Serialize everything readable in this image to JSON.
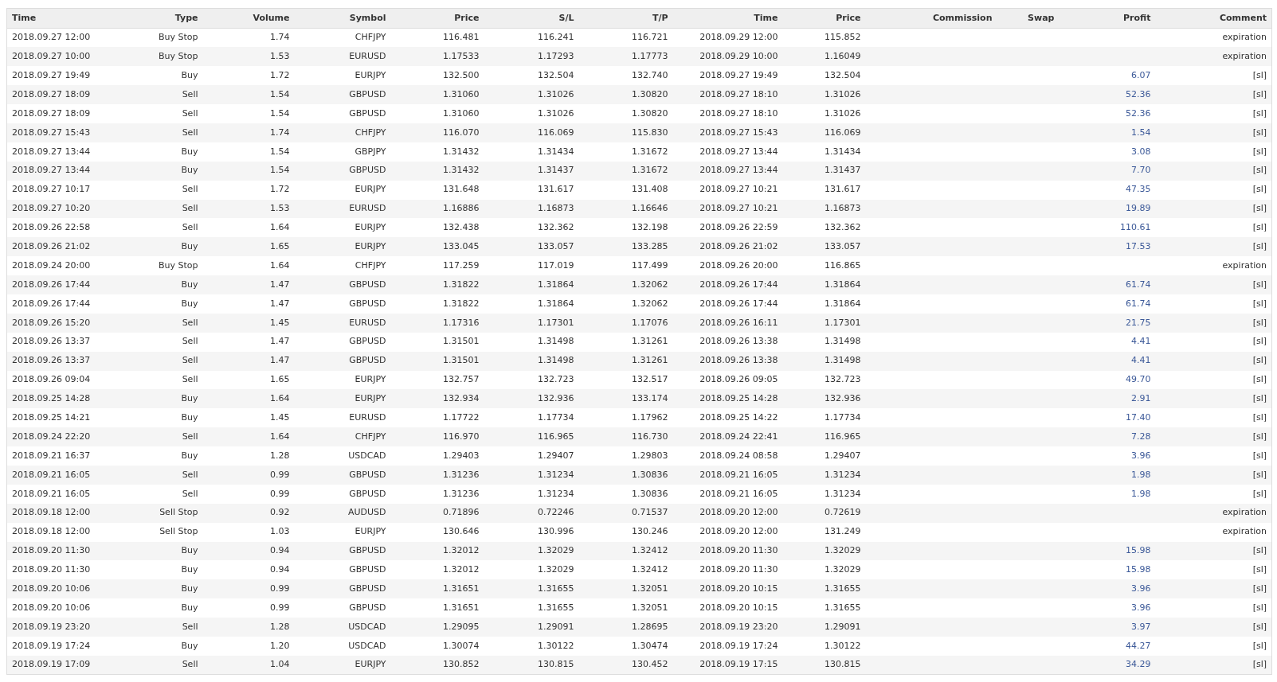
{
  "table": {
    "columns": [
      "Time",
      "Type",
      "Volume",
      "Symbol",
      "Price",
      "S/L",
      "T/P",
      "Time",
      "Price",
      "Commission",
      "Swap",
      "Profit",
      "Comment"
    ],
    "rows": [
      {
        "open_time": "2018.09.27 12:00",
        "type": "Buy Stop",
        "volume": "1.74",
        "symbol": "CHFJPY",
        "price": "116.481",
        "sl": "116.241",
        "tp": "116.721",
        "close_time": "2018.09.29 12:00",
        "close_price": "115.852",
        "comment": "expiration"
      },
      {
        "open_time": "2018.09.27 10:00",
        "type": "Buy Stop",
        "volume": "1.53",
        "symbol": "EURUSD",
        "price": "1.17533",
        "sl": "1.17293",
        "tp": "1.17773",
        "close_time": "2018.09.29 10:00",
        "close_price": "1.16049",
        "comment": "expiration"
      },
      {
        "open_time": "2018.09.27 19:49",
        "type": "Buy",
        "volume": "1.72",
        "symbol": "EURJPY",
        "price": "132.500",
        "sl": "132.504",
        "tp": "132.740",
        "close_time": "2018.09.27 19:49",
        "close_price": "132.504",
        "profit": "6.07",
        "comment": "[sl]"
      },
      {
        "open_time": "2018.09.27 18:09",
        "type": "Sell",
        "volume": "1.54",
        "symbol": "GBPUSD",
        "price": "1.31060",
        "sl": "1.31026",
        "tp": "1.30820",
        "close_time": "2018.09.27 18:10",
        "close_price": "1.31026",
        "profit": "52.36",
        "comment": "[sl]"
      },
      {
        "open_time": "2018.09.27 18:09",
        "type": "Sell",
        "volume": "1.54",
        "symbol": "GBPUSD",
        "price": "1.31060",
        "sl": "1.31026",
        "tp": "1.30820",
        "close_time": "2018.09.27 18:10",
        "close_price": "1.31026",
        "profit": "52.36",
        "comment": "[sl]"
      },
      {
        "open_time": "2018.09.27 15:43",
        "type": "Sell",
        "volume": "1.74",
        "symbol": "CHFJPY",
        "price": "116.070",
        "sl": "116.069",
        "tp": "115.830",
        "close_time": "2018.09.27 15:43",
        "close_price": "116.069",
        "profit": "1.54",
        "comment": "[sl]"
      },
      {
        "open_time": "2018.09.27 13:44",
        "type": "Buy",
        "volume": "1.54",
        "symbol": "GBPJPY",
        "price": "1.31432",
        "sl": "1.31434",
        "tp": "1.31672",
        "close_time": "2018.09.27 13:44",
        "close_price": "1.31434",
        "profit": "3.08",
        "comment": "[sl]"
      },
      {
        "open_time": "2018.09.27 13:44",
        "type": "Buy",
        "volume": "1.54",
        "symbol": "GBPUSD",
        "price": "1.31432",
        "sl": "1.31437",
        "tp": "1.31672",
        "close_time": "2018.09.27 13:44",
        "close_price": "1.31437",
        "profit": "7.70",
        "comment": "[sl]"
      },
      {
        "open_time": "2018.09.27 10:17",
        "type": "Sell",
        "volume": "1.72",
        "symbol": "EURJPY",
        "price": "131.648",
        "sl": "131.617",
        "tp": "131.408",
        "close_time": "2018.09.27 10:21",
        "close_price": "131.617",
        "profit": "47.35",
        "comment": "[sl]"
      },
      {
        "open_time": "2018.09.27 10:20",
        "type": "Sell",
        "volume": "1.53",
        "symbol": "EURUSD",
        "price": "1.16886",
        "sl": "1.16873",
        "tp": "1.16646",
        "close_time": "2018.09.27 10:21",
        "close_price": "1.16873",
        "profit": "19.89",
        "comment": "[sl]"
      },
      {
        "open_time": "2018.09.26 22:58",
        "type": "Sell",
        "volume": "1.64",
        "symbol": "EURJPY",
        "price": "132.438",
        "sl": "132.362",
        "tp": "132.198",
        "close_time": "2018.09.26 22:59",
        "close_price": "132.362",
        "profit": "110.61",
        "comment": "[sl]"
      },
      {
        "open_time": "2018.09.26 21:02",
        "type": "Buy",
        "volume": "1.65",
        "symbol": "EURJPY",
        "price": "133.045",
        "sl": "133.057",
        "tp": "133.285",
        "close_time": "2018.09.26 21:02",
        "close_price": "133.057",
        "profit": "17.53",
        "comment": "[sl]"
      },
      {
        "open_time": "2018.09.24 20:00",
        "type": "Buy Stop",
        "volume": "1.64",
        "symbol": "CHFJPY",
        "price": "117.259",
        "sl": "117.019",
        "tp": "117.499",
        "close_time": "2018.09.26 20:00",
        "close_price": "116.865",
        "comment": "expiration"
      },
      {
        "open_time": "2018.09.26 17:44",
        "type": "Buy",
        "volume": "1.47",
        "symbol": "GBPUSD",
        "price": "1.31822",
        "sl": "1.31864",
        "tp": "1.32062",
        "close_time": "2018.09.26 17:44",
        "close_price": "1.31864",
        "profit": "61.74",
        "comment": "[sl]"
      },
      {
        "open_time": "2018.09.26 17:44",
        "type": "Buy",
        "volume": "1.47",
        "symbol": "GBPUSD",
        "price": "1.31822",
        "sl": "1.31864",
        "tp": "1.32062",
        "close_time": "2018.09.26 17:44",
        "close_price": "1.31864",
        "profit": "61.74",
        "comment": "[sl]"
      },
      {
        "open_time": "2018.09.26 15:20",
        "type": "Sell",
        "volume": "1.45",
        "symbol": "EURUSD",
        "price": "1.17316",
        "sl": "1.17301",
        "tp": "1.17076",
        "close_time": "2018.09.26 16:11",
        "close_price": "1.17301",
        "profit": "21.75",
        "comment": "[sl]"
      },
      {
        "open_time": "2018.09.26 13:37",
        "type": "Sell",
        "volume": "1.47",
        "symbol": "GBPUSD",
        "price": "1.31501",
        "sl": "1.31498",
        "tp": "1.31261",
        "close_time": "2018.09.26 13:38",
        "close_price": "1.31498",
        "profit": "4.41",
        "comment": "[sl]"
      },
      {
        "open_time": "2018.09.26 13:37",
        "type": "Sell",
        "volume": "1.47",
        "symbol": "GBPUSD",
        "price": "1.31501",
        "sl": "1.31498",
        "tp": "1.31261",
        "close_time": "2018.09.26 13:38",
        "close_price": "1.31498",
        "profit": "4.41",
        "comment": "[sl]"
      },
      {
        "open_time": "2018.09.26 09:04",
        "type": "Sell",
        "volume": "1.65",
        "symbol": "EURJPY",
        "price": "132.757",
        "sl": "132.723",
        "tp": "132.517",
        "close_time": "2018.09.26 09:05",
        "close_price": "132.723",
        "profit": "49.70",
        "comment": "[sl]"
      },
      {
        "open_time": "2018.09.25 14:28",
        "type": "Buy",
        "volume": "1.64",
        "symbol": "EURJPY",
        "price": "132.934",
        "sl": "132.936",
        "tp": "133.174",
        "close_time": "2018.09.25 14:28",
        "close_price": "132.936",
        "profit": "2.91",
        "comment": "[sl]"
      },
      {
        "open_time": "2018.09.25 14:21",
        "type": "Buy",
        "volume": "1.45",
        "symbol": "EURUSD",
        "price": "1.17722",
        "sl": "1.17734",
        "tp": "1.17962",
        "close_time": "2018.09.25 14:22",
        "close_price": "1.17734",
        "profit": "17.40",
        "comment": "[sl]"
      },
      {
        "open_time": "2018.09.24 22:20",
        "type": "Sell",
        "volume": "1.64",
        "symbol": "CHFJPY",
        "price": "116.970",
        "sl": "116.965",
        "tp": "116.730",
        "close_time": "2018.09.24 22:41",
        "close_price": "116.965",
        "profit": "7.28",
        "comment": "[sl]"
      },
      {
        "open_time": "2018.09.21 16:37",
        "type": "Buy",
        "volume": "1.28",
        "symbol": "USDCAD",
        "price": "1.29403",
        "sl": "1.29407",
        "tp": "1.29803",
        "close_time": "2018.09.24 08:58",
        "close_price": "1.29407",
        "profit": "3.96",
        "comment": "[sl]"
      },
      {
        "open_time": "2018.09.21 16:05",
        "type": "Sell",
        "volume": "0.99",
        "symbol": "GBPUSD",
        "price": "1.31236",
        "sl": "1.31234",
        "tp": "1.30836",
        "close_time": "2018.09.21 16:05",
        "close_price": "1.31234",
        "profit": "1.98",
        "comment": "[sl]"
      },
      {
        "open_time": "2018.09.21 16:05",
        "type": "Sell",
        "volume": "0.99",
        "symbol": "GBPUSD",
        "price": "1.31236",
        "sl": "1.31234",
        "tp": "1.30836",
        "close_time": "2018.09.21 16:05",
        "close_price": "1.31234",
        "profit": "1.98",
        "comment": "[sl]"
      },
      {
        "open_time": "2018.09.18 12:00",
        "type": "Sell Stop",
        "volume": "0.92",
        "symbol": "AUDUSD",
        "price": "0.71896",
        "sl": "0.72246",
        "tp": "0.71537",
        "close_time": "2018.09.20 12:00",
        "close_price": "0.72619",
        "comment": "expiration"
      },
      {
        "open_time": "2018.09.18 12:00",
        "type": "Sell Stop",
        "volume": "1.03",
        "symbol": "EURJPY",
        "price": "130.646",
        "sl": "130.996",
        "tp": "130.246",
        "close_time": "2018.09.20 12:00",
        "close_price": "131.249",
        "comment": "expiration"
      },
      {
        "open_time": "2018.09.20 11:30",
        "type": "Buy",
        "volume": "0.94",
        "symbol": "GBPUSD",
        "price": "1.32012",
        "sl": "1.32029",
        "tp": "1.32412",
        "close_time": "2018.09.20 11:30",
        "close_price": "1.32029",
        "profit": "15.98",
        "comment": "[sl]"
      },
      {
        "open_time": "2018.09.20 11:30",
        "type": "Buy",
        "volume": "0.94",
        "symbol": "GBPUSD",
        "price": "1.32012",
        "sl": "1.32029",
        "tp": "1.32412",
        "close_time": "2018.09.20 11:30",
        "close_price": "1.32029",
        "profit": "15.98",
        "comment": "[sl]"
      },
      {
        "open_time": "2018.09.20 10:06",
        "type": "Buy",
        "volume": "0.99",
        "symbol": "GBPUSD",
        "price": "1.31651",
        "sl": "1.31655",
        "tp": "1.32051",
        "close_time": "2018.09.20 10:15",
        "close_price": "1.31655",
        "profit": "3.96",
        "comment": "[sl]"
      },
      {
        "open_time": "2018.09.20 10:06",
        "type": "Buy",
        "volume": "0.99",
        "symbol": "GBPUSD",
        "price": "1.31651",
        "sl": "1.31655",
        "tp": "1.32051",
        "close_time": "2018.09.20 10:15",
        "close_price": "1.31655",
        "profit": "3.96",
        "comment": "[sl]"
      },
      {
        "open_time": "2018.09.19 23:20",
        "type": "Sell",
        "volume": "1.28",
        "symbol": "USDCAD",
        "price": "1.29095",
        "sl": "1.29091",
        "tp": "1.28695",
        "close_time": "2018.09.19 23:20",
        "close_price": "1.29091",
        "profit": "3.97",
        "comment": "[sl]"
      },
      {
        "open_time": "2018.09.19 17:24",
        "type": "Buy",
        "volume": "1.20",
        "symbol": "USDCAD",
        "price": "1.30074",
        "sl": "1.30122",
        "tp": "1.30474",
        "close_time": "2018.09.19 17:24",
        "close_price": "1.30122",
        "profit": "44.27",
        "comment": "[sl]"
      },
      {
        "open_time": "2018.09.19 17:09",
        "type": "Sell",
        "volume": "1.04",
        "symbol": "EURJPY",
        "price": "130.852",
        "sl": "130.815",
        "tp": "130.452",
        "close_time": "2018.09.19 17:15",
        "close_price": "130.815",
        "profit": "34.29",
        "comment": "[sl]"
      }
    ]
  }
}
